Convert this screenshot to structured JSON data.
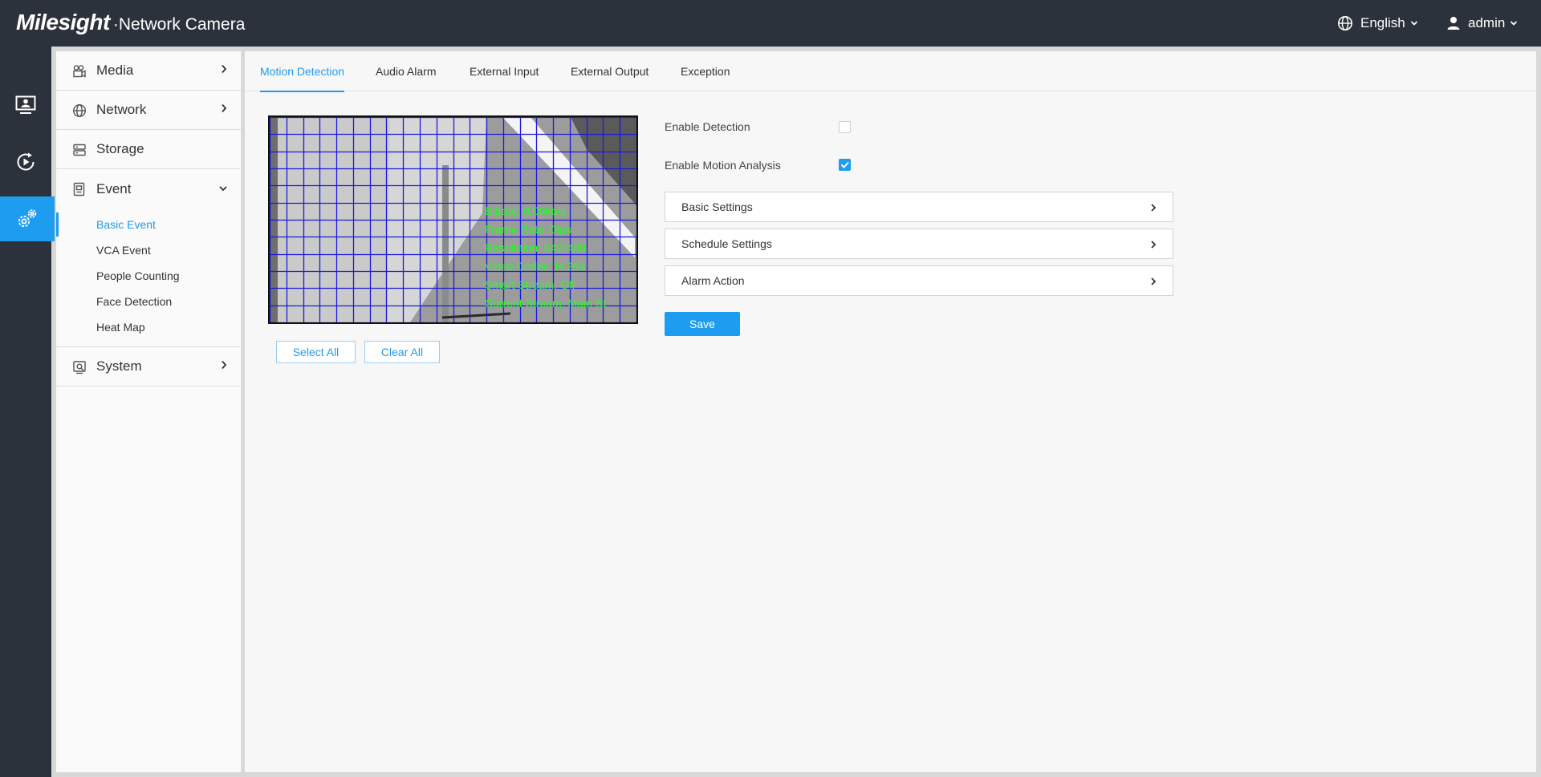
{
  "header": {
    "brand": "Milesight",
    "product": "·Network Camera",
    "language": "English",
    "user": "admin"
  },
  "rail": {
    "items": [
      {
        "icon": "live-view-icon"
      },
      {
        "icon": "playback-icon"
      },
      {
        "icon": "settings-icon",
        "active": true
      }
    ]
  },
  "menu": {
    "groups": [
      {
        "label": "Media",
        "icon": "camera-icon"
      },
      {
        "label": "Network",
        "icon": "globe-icon"
      },
      {
        "label": "Storage",
        "icon": "storage-icon"
      },
      {
        "label": "Event",
        "icon": "event-icon",
        "expanded": true
      },
      {
        "label": "System",
        "icon": "system-icon"
      }
    ],
    "event_items": [
      "Basic Event",
      "VCA Event",
      "People Counting",
      "Face Detection",
      "Heat Map"
    ],
    "active_item": "Basic Event"
  },
  "tabs": [
    "Motion Detection",
    "Audio Alarm",
    "External Input",
    "External Output",
    "Exception"
  ],
  "active_tab": "Motion Detection",
  "preview": {
    "osd_lines": [
      "Bitrate: 0.00kb/s",
      "Frame Rate: 0fps",
      "Resolution: 640*480",
      "Video Codec: H.264",
      "Smart Stream: Off",
      "Current Stream: Main St"
    ],
    "grid_color": "#1a1adc"
  },
  "buttons": {
    "select_all": "Select All",
    "clear_all": "Clear All",
    "save": "Save"
  },
  "settings": {
    "enable_detection": {
      "label": "Enable Detection",
      "checked": false
    },
    "enable_motion_analysis": {
      "label": "Enable Motion Analysis",
      "checked": true
    },
    "sections": [
      "Basic Settings",
      "Schedule Settings",
      "Alarm Action"
    ]
  },
  "colors": {
    "accent": "#1e9cf0",
    "header_bg": "#2c323b"
  }
}
